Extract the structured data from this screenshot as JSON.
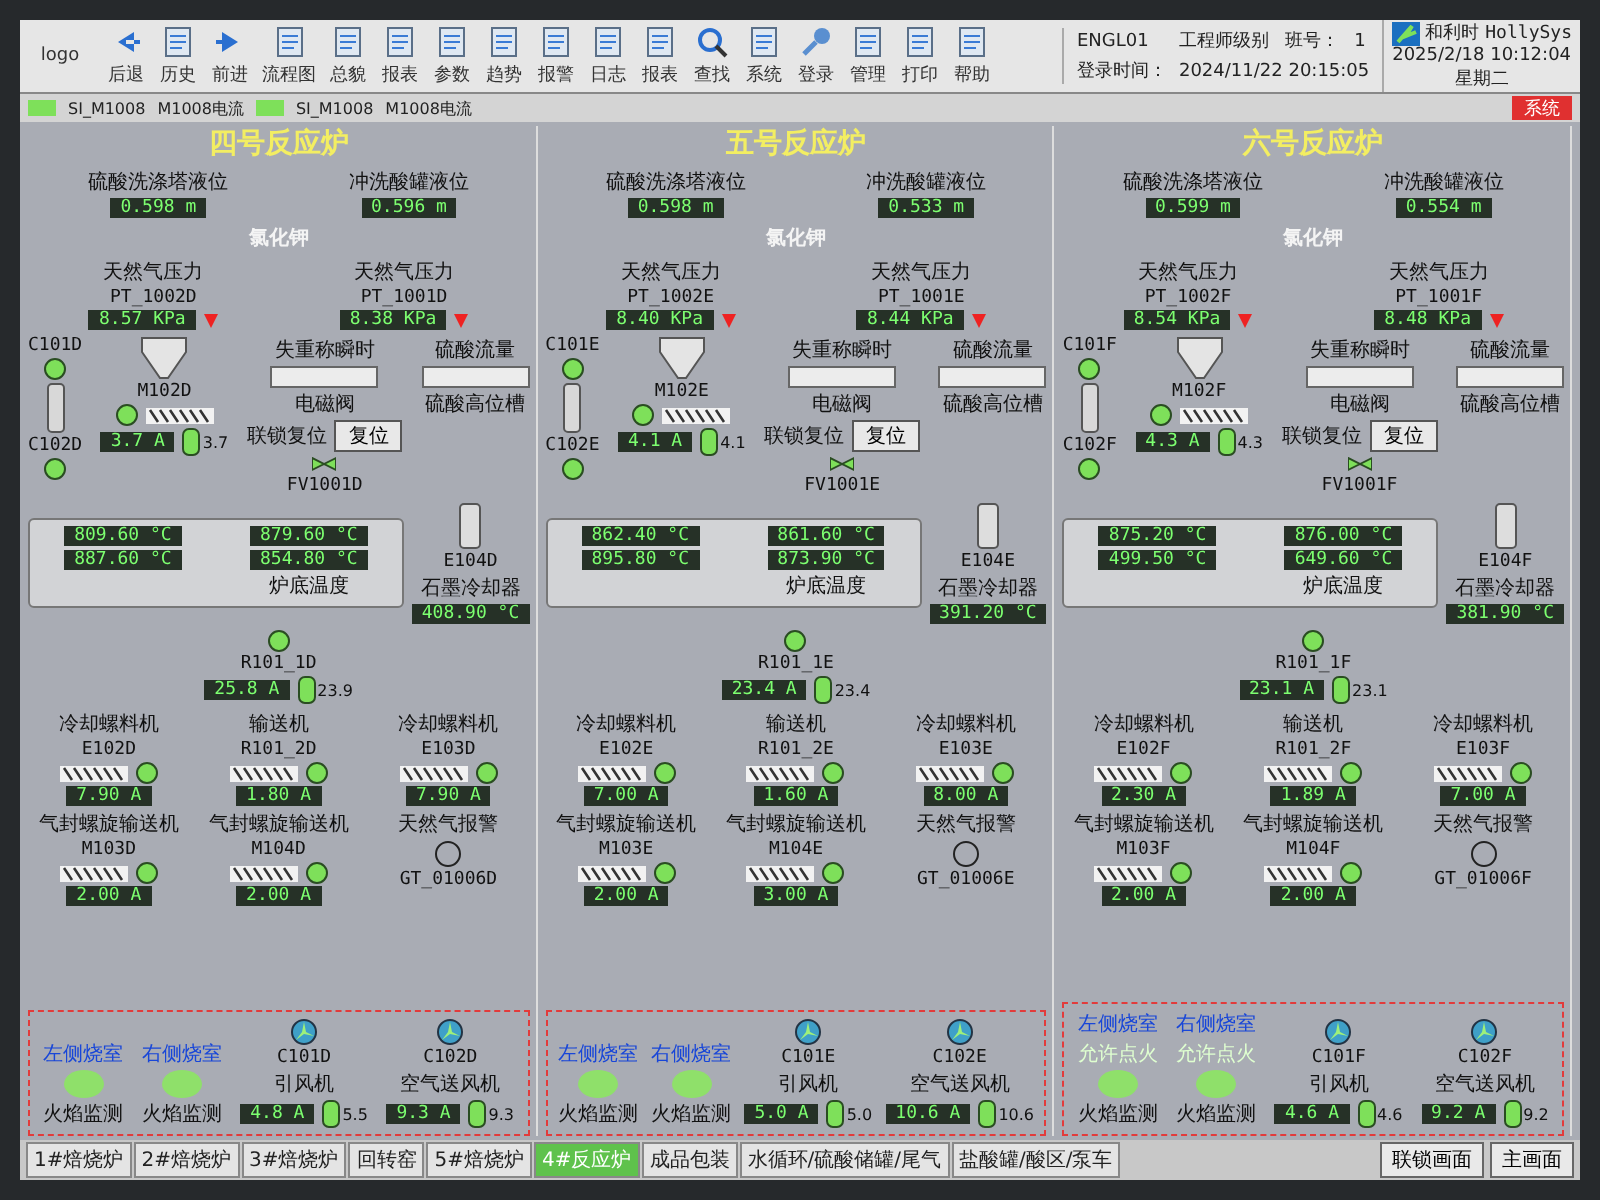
{
  "toolbar": {
    "logo": "logo",
    "buttons": [
      {
        "label": "后退",
        "kind": "left"
      },
      {
        "label": "历史",
        "kind": "page"
      },
      {
        "label": "前进",
        "kind": "right"
      },
      {
        "label": "流程图",
        "kind": "page"
      },
      {
        "label": "总貌",
        "kind": "page"
      },
      {
        "label": "报表",
        "kind": "page"
      },
      {
        "label": "参数",
        "kind": "page"
      },
      {
        "label": "趋势",
        "kind": "page"
      },
      {
        "label": "报警",
        "kind": "page"
      },
      {
        "label": "日志",
        "kind": "page"
      },
      {
        "label": "报表",
        "kind": "page"
      },
      {
        "label": "查找",
        "kind": "search"
      },
      {
        "label": "系统",
        "kind": "page"
      },
      {
        "label": "登录",
        "kind": "key"
      },
      {
        "label": "管理",
        "kind": "page"
      },
      {
        "label": "打印",
        "kind": "page"
      },
      {
        "label": "帮助",
        "kind": "page"
      }
    ]
  },
  "user": {
    "name": "ENGL01",
    "level": "工程师级别",
    "shift_label": "班号：",
    "shift": "1",
    "login_label": "登录时间：",
    "login_time": "2024/11/22 20:15:05"
  },
  "brand": {
    "name": "和利时",
    "sub": "HollySys",
    "datetime": "2025/2/18 10:12:04",
    "weekday": "星期二"
  },
  "status": {
    "items": [
      {
        "tag": "SI_M1008",
        "label": "M1008电流"
      },
      {
        "tag": "SI_M1008",
        "label": "M1008电流"
      }
    ],
    "system": "系统"
  },
  "reactors": [
    {
      "title": "四号反应炉",
      "levels": [
        {
          "label": "硫酸洗涤塔液位",
          "value": "0.598 m"
        },
        {
          "label": "冲洗酸罐液位",
          "value": "0.596 m"
        }
      ],
      "chloride": "氯化钾",
      "pressures": [
        {
          "label": "天然气压力",
          "tag": "PT_1002D",
          "value": "8.57 KPa"
        },
        {
          "label": "天然气压力",
          "tag": "PT_1001D",
          "value": "8.38 KPa"
        }
      ],
      "small_fans": [
        "C101D",
        "C102D"
      ],
      "hopper": {
        "tag": "M102D",
        "value": "3.7 A",
        "gauge": "3.7"
      },
      "feeder": "失重称瞬时",
      "valve": {
        "label": "电磁阀",
        "label2": "联锁复位",
        "button": "复位",
        "tag": "FV1001D"
      },
      "flow": "硫酸流量",
      "tank": "硫酸高位槽",
      "temps": [
        {
          "value": "809.60 °C"
        },
        {
          "value": "879.60 °C"
        },
        {
          "value": "887.60 °C"
        },
        {
          "value": "854.80 °C",
          "label": "炉底温度"
        }
      ],
      "graphite": {
        "tag": "E104D",
        "label": "石墨冷却器",
        "value": "408.90 °C"
      },
      "main_motor": {
        "tag": "R101_1D",
        "value": "25.8 A",
        "gauge": "23.9"
      },
      "equipment": [
        {
          "name": "冷却螺料机",
          "tag": "E102D",
          "value": "7.90 A"
        },
        {
          "name": "输送机",
          "tag": "R101_2D",
          "value": "1.80 A"
        },
        {
          "name": "冷却螺料机",
          "tag": "E103D",
          "value": "7.90 A"
        },
        {
          "name": "气封螺旋输送机",
          "tag": "M103D",
          "value": "2.00 A"
        },
        {
          "name": "气封螺旋输送机",
          "tag": "M104D",
          "value": "2.00 A"
        }
      ],
      "alarm": {
        "label": "天然气报警",
        "tag": "GT_01006D"
      },
      "burners": [
        {
          "label": "左侧烧室",
          "monitor": "火焰监测",
          "on": true
        },
        {
          "label": "右侧烧室",
          "monitor": "火焰监测",
          "on": true
        }
      ],
      "fans": [
        {
          "tag": "C101D",
          "name": "引风机",
          "value": "4.8 A",
          "gauge": "5.5"
        },
        {
          "tag": "C102D",
          "name": "空气送风机",
          "value": "9.3 A",
          "gauge": "9.3"
        }
      ]
    },
    {
      "title": "五号反应炉",
      "levels": [
        {
          "label": "硫酸洗涤塔液位",
          "value": "0.598 m"
        },
        {
          "label": "冲洗酸罐液位",
          "value": "0.533 m"
        }
      ],
      "chloride": "氯化钾",
      "pressures": [
        {
          "label": "天然气压力",
          "tag": "PT_1002E",
          "value": "8.40 KPa"
        },
        {
          "label": "天然气压力",
          "tag": "PT_1001E",
          "value": "8.44 KPa"
        }
      ],
      "small_fans": [
        "C101E",
        "C102E"
      ],
      "hopper": {
        "tag": "M102E",
        "value": "4.1 A",
        "gauge": "4.1"
      },
      "feeder": "失重称瞬时",
      "valve": {
        "label": "电磁阀",
        "label2": "联锁复位",
        "button": "复位",
        "tag": "FV1001E"
      },
      "flow": "硫酸流量",
      "tank": "硫酸高位槽",
      "temps": [
        {
          "value": "862.40 °C"
        },
        {
          "value": "861.60 °C"
        },
        {
          "value": "895.80 °C"
        },
        {
          "value": "873.90 °C",
          "label": "炉底温度"
        }
      ],
      "graphite": {
        "tag": "E104E",
        "label": "石墨冷却器",
        "value": "391.20 °C"
      },
      "main_motor": {
        "tag": "R101_1E",
        "value": "23.4 A",
        "gauge": "23.4"
      },
      "equipment": [
        {
          "name": "冷却螺料机",
          "tag": "E102E",
          "value": "7.00 A"
        },
        {
          "name": "输送机",
          "tag": "R101_2E",
          "value": "1.60 A"
        },
        {
          "name": "冷却螺料机",
          "tag": "E103E",
          "value": "8.00 A"
        },
        {
          "name": "气封螺旋输送机",
          "tag": "M103E",
          "value": "2.00 A"
        },
        {
          "name": "气封螺旋输送机",
          "tag": "M104E",
          "value": "3.00 A"
        }
      ],
      "alarm": {
        "label": "天然气报警",
        "tag": "GT_01006E"
      },
      "burners": [
        {
          "label": "左侧烧室",
          "monitor": "火焰监测",
          "on": true
        },
        {
          "label": "右侧烧室",
          "monitor": "火焰监测",
          "on": true
        }
      ],
      "fans": [
        {
          "tag": "C101E",
          "name": "引风机",
          "value": "5.0 A",
          "gauge": "5.0"
        },
        {
          "tag": "C102E",
          "name": "空气送风机",
          "value": "10.6 A",
          "gauge": "10.6"
        }
      ]
    },
    {
      "title": "六号反应炉",
      "levels": [
        {
          "label": "硫酸洗涤塔液位",
          "value": "0.599 m"
        },
        {
          "label": "冲洗酸罐液位",
          "value": "0.554 m"
        }
      ],
      "chloride": "氯化钾",
      "pressures": [
        {
          "label": "天然气压力",
          "tag": "PT_1002F",
          "value": "8.54 KPa"
        },
        {
          "label": "天然气压力",
          "tag": "PT_1001F",
          "value": "8.48 KPa"
        }
      ],
      "small_fans": [
        "C101F",
        "C102F"
      ],
      "hopper": {
        "tag": "M102F",
        "value": "4.3 A",
        "gauge": "4.3"
      },
      "feeder": "失重称瞬时",
      "valve": {
        "label": "电磁阀",
        "label2": "联锁复位",
        "button": "复位",
        "tag": "FV1001F"
      },
      "flow": "硫酸流量",
      "tank": "硫酸高位槽",
      "temps": [
        {
          "value": "875.20 °C"
        },
        {
          "value": "876.00 °C"
        },
        {
          "value": "499.50 °C"
        },
        {
          "value": "649.60 °C",
          "label": "炉底温度"
        }
      ],
      "graphite": {
        "tag": "E104F",
        "label": "石墨冷却器",
        "value": "381.90 °C"
      },
      "main_motor": {
        "tag": "R101_1F",
        "value": "23.1 A",
        "gauge": "23.1"
      },
      "equipment": [
        {
          "name": "冷却螺料机",
          "tag": "E102F",
          "value": "2.30 A"
        },
        {
          "name": "输送机",
          "tag": "R101_2F",
          "value": "1.89 A"
        },
        {
          "name": "冷却螺料机",
          "tag": "E103F",
          "value": "7.00 A"
        },
        {
          "name": "气封螺旋输送机",
          "tag": "M103F",
          "value": "2.00 A"
        },
        {
          "name": "气封螺旋输送机",
          "tag": "M104F",
          "value": "2.00 A"
        }
      ],
      "alarm": {
        "label": "天然气报警",
        "tag": "GT_01006F"
      },
      "burners": [
        {
          "label": "左侧烧室",
          "status": "允许点火",
          "monitor": "火焰监测",
          "on": true
        },
        {
          "label": "右侧烧室",
          "status": "允许点火",
          "monitor": "火焰监测",
          "on": true
        }
      ],
      "fans": [
        {
          "tag": "C101F",
          "name": "引风机",
          "value": "4.6 A",
          "gauge": "4.6"
        },
        {
          "tag": "C102F",
          "name": "空气送风机",
          "value": "9.2 A",
          "gauge": "9.2"
        }
      ]
    }
  ],
  "tabs": [
    {
      "label": "1#焙烧炉",
      "selected": false
    },
    {
      "label": "2#焙烧炉",
      "selected": false
    },
    {
      "label": "3#焙烧炉",
      "selected": false
    },
    {
      "label": "回转窑",
      "selected": false
    },
    {
      "label": "5#焙烧炉",
      "selected": false
    },
    {
      "label": "4#反应炉",
      "selected": true
    },
    {
      "label": "成品包装",
      "selected": false
    },
    {
      "label": "水循环/硫酸储罐/尾气",
      "selected": false
    },
    {
      "label": "盐酸罐/酸区/泵车",
      "selected": false
    }
  ],
  "nav_buttons": [
    "联锁画面",
    "主画面"
  ]
}
